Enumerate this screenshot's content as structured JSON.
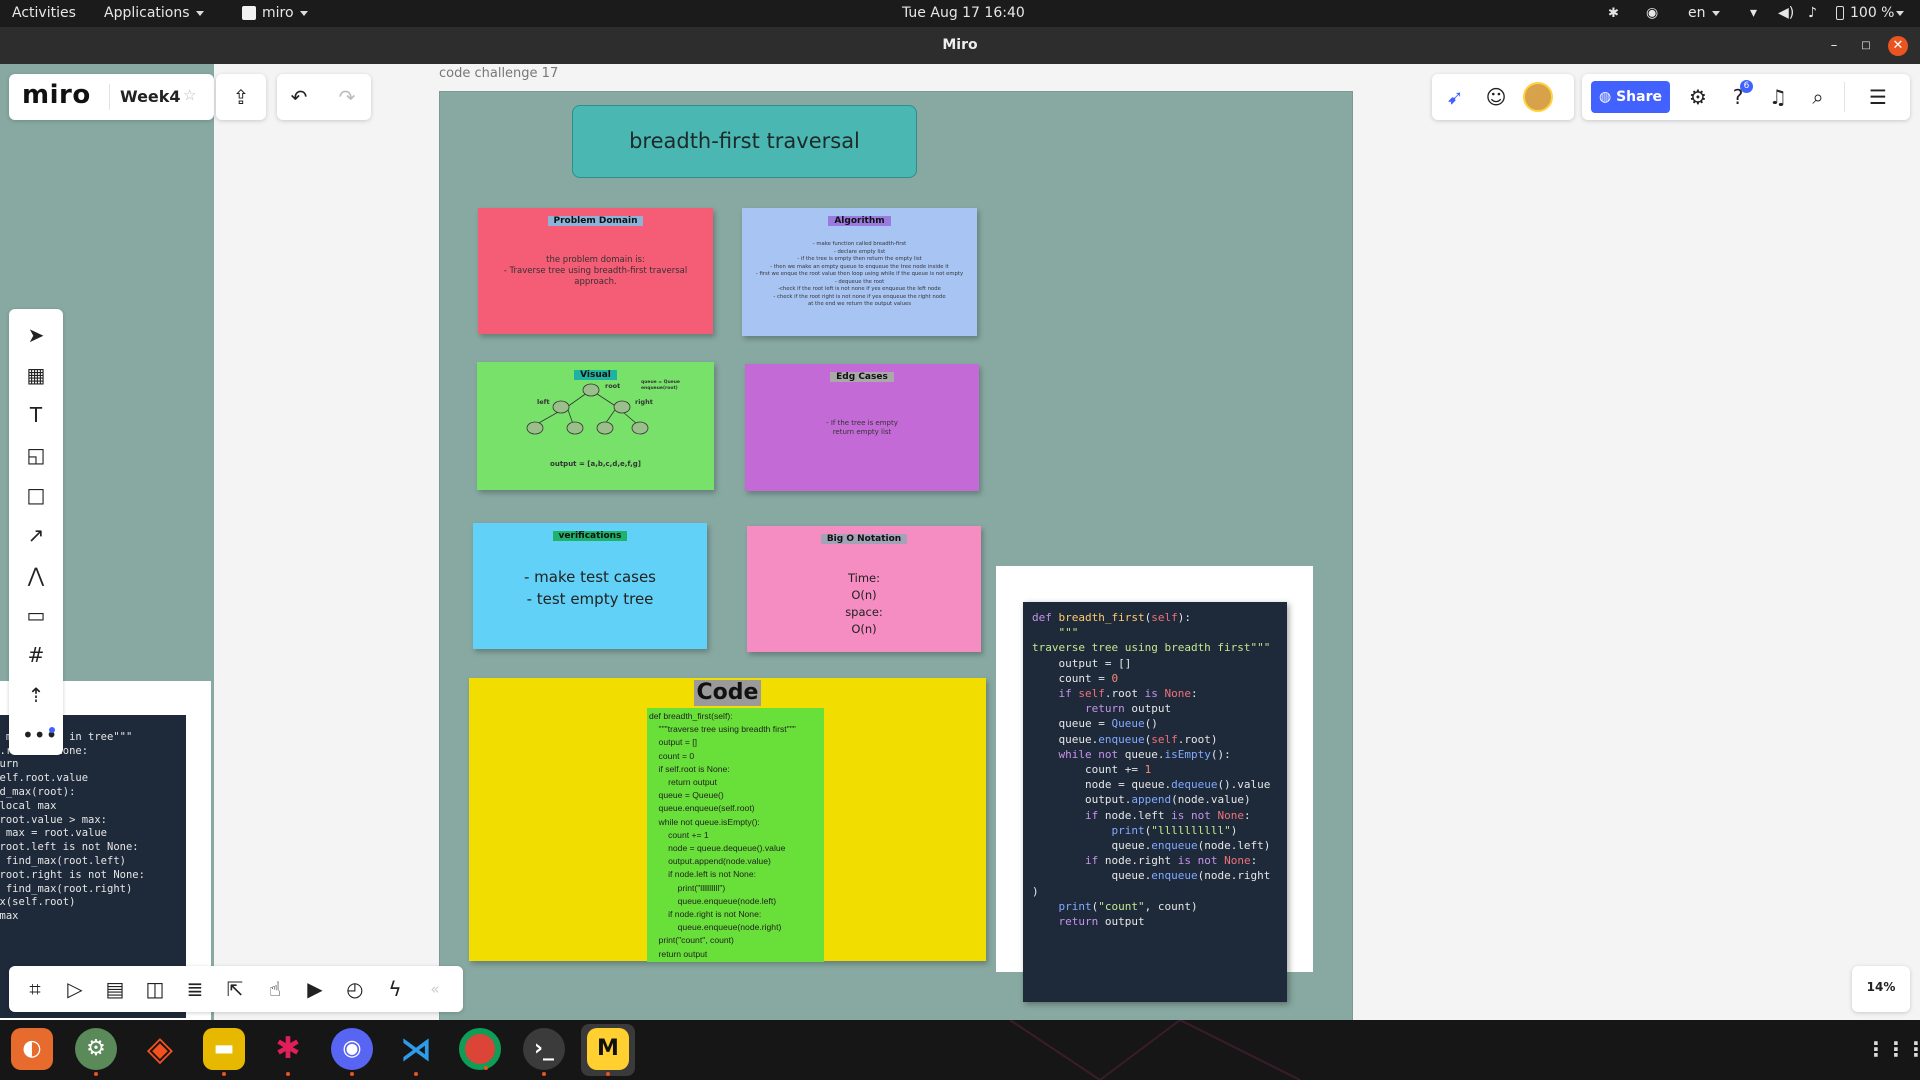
{
  "topbar": {
    "activities": "Activities",
    "applications": "Applications",
    "app_menu": "miro",
    "datetime": "Tue Aug 17  16:40",
    "lang": "en",
    "battery": "100 %"
  },
  "window": {
    "title": "Miro"
  },
  "board": {
    "logo": "miro",
    "name": "Week4",
    "frame_label": "code challenge 17",
    "share_label": "Share",
    "zoom": "14%",
    "notification_count": "6"
  },
  "header_card": {
    "text": "breadth-first traversal"
  },
  "stickies": {
    "problem": {
      "title": "Problem Domain",
      "body": "the problem domain is:\n- Traverse tree using breadth-first traversal approach."
    },
    "algorithm": {
      "title": "Algorithm",
      "body": "- make function called breadth-first\n- declare empty list\n- if the tree is empty then return the empty list\n- then we make an empty queue to enqueue the tree node inside it\n- first we enque the root value then loop using while if the queue is not empty\n- dequeue the root\n-check if the root left is not none if yes enqueue the left node\n- check if the root right is not none if yes enqueue the right node\nat the end we return the output values"
    },
    "visual": {
      "title": "Visual",
      "root": "root",
      "left": "left",
      "right": "right",
      "queue_note": "queue = Queue\nenqueue(root)",
      "output": "output = [a,b,c,d,e,f,g]"
    },
    "edge": {
      "title": "Edg Cases",
      "body": "- If the tree is empty\nreturn empty list"
    },
    "verifications": {
      "title": "verifications",
      "body": "- make test cases\n- test empty tree"
    },
    "bigo": {
      "title": "Big O Notation",
      "body": "Time:\nO(n)\nspace:\nO(n)"
    },
    "code": {
      "title": "Code",
      "body": "def breadth_first(self):\n    \"\"\"traverse tree using breadth first\"\"\"\n    output = []\n    count = 0\n    if self.root is None:\n        return output\n    queue = Queue()\n    queue.enqueue(self.root)\n    while not queue.isEmpty():\n        count += 1\n        node = queue.dequeue().value\n        output.append(node.value)\n        if node.left is not None:\n            print(\"llllllllll\")\n            queue.enqueue(node.left)\n        if node.right is not None:\n            queue.enqueue(node.right)\n    print(\"count\", count)\n    return output"
    }
  },
  "left_code_fragment": "  \"\"\"\n    \"\"\"find max value in tree\"\"\"\n    if self.root is None:\n        return\n    max = self.root.value\n    def find_max(root):\n        nonlocal max\n        if root.value > max:\n            max = root.value\n        if root.left is not None:\n            find_max(root.left)\n        if root.right is not None:\n            find_max(root.right)\n    find_max(self.root)\n    return max",
  "dock_apps": [
    "ubuntu-software",
    "settings",
    "brave",
    "files",
    "slack",
    "discord",
    "vscode",
    "chrome",
    "terminal",
    "miro"
  ]
}
